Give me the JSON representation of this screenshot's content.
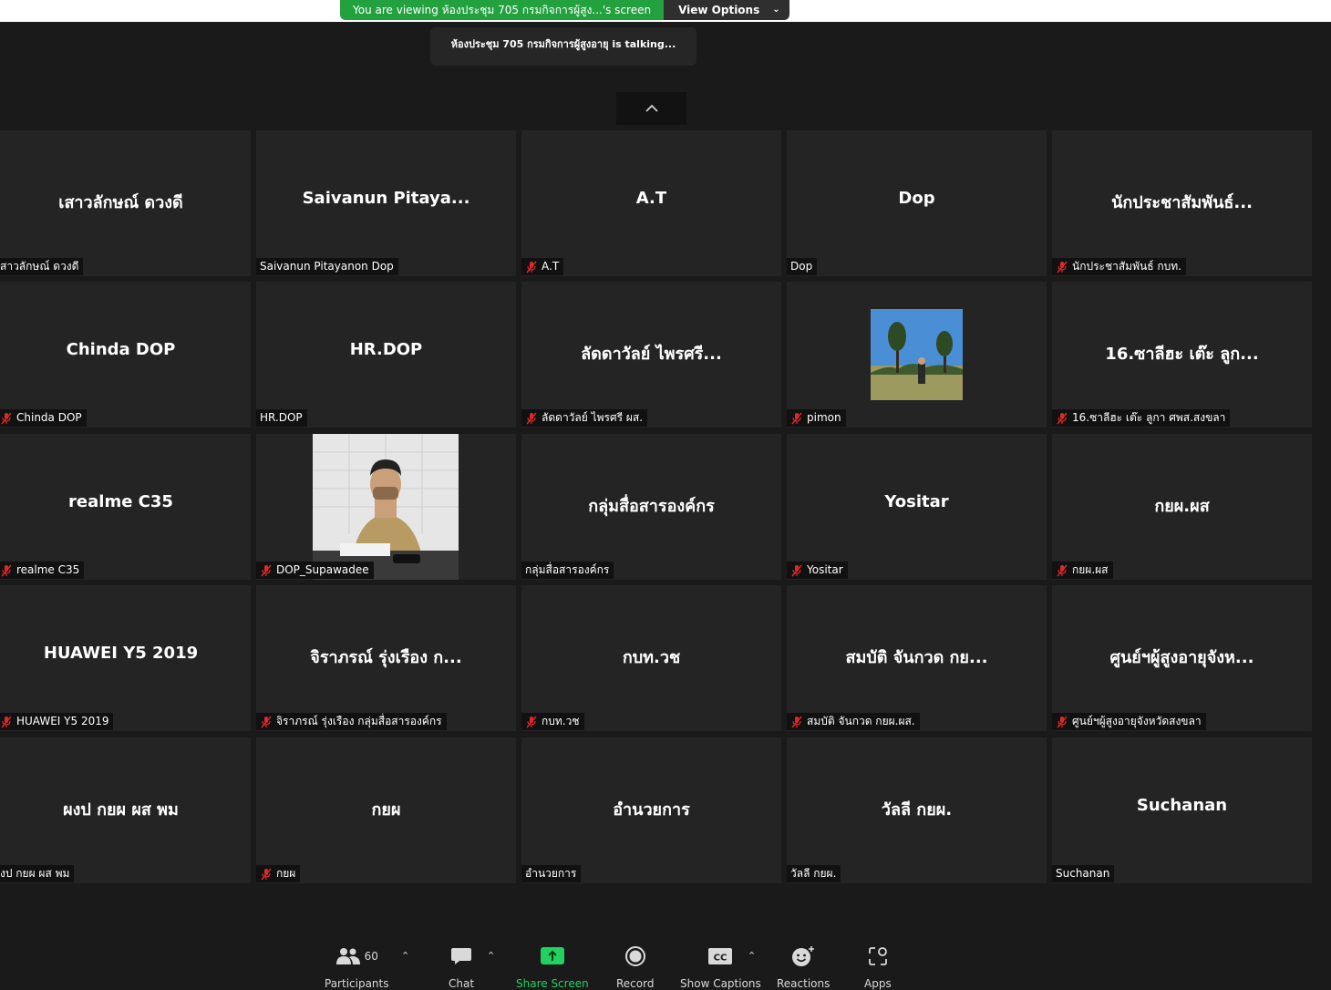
{
  "banner": {
    "viewing_text": "You are viewing ห้องประชุม 705 กรมกิจการผู้สูง...'s screen",
    "view_options": "View Options"
  },
  "talking_notice": "ห้องประชุม 705 กรมกิจการผู้สูงอายุ is talking...",
  "tiles": [
    {
      "title": "เสาวลักษณ์ ดวงดี",
      "label": "สาวลักษณ์ ดวงดี",
      "muted": false
    },
    {
      "title": "Saivanun  Pitaya...",
      "label": "Saivanun Pitayanon Dop",
      "muted": false
    },
    {
      "title": "A.T",
      "label": "A.T",
      "muted": true
    },
    {
      "title": "Dop",
      "label": "Dop",
      "muted": false
    },
    {
      "title": "นักประชาสัมพันธ์...",
      "label": "นักประชาสัมพันธ์ กบท.",
      "muted": true
    },
    {
      "title": "Chinda DOP",
      "label": "Chinda DOP",
      "muted": true
    },
    {
      "title": "HR.DOP",
      "label": "HR.DOP",
      "muted": false
    },
    {
      "title": "ลัดดาวัลย์ ไพรศรี...",
      "label": "ลัดดาวัลย์ ไพรศรี ผส.",
      "muted": true
    },
    {
      "title": "",
      "label": "pimon",
      "muted": true,
      "photo": "pimon"
    },
    {
      "title": "16.ซาลีฮะ เต๊ะ ลูก...",
      "label": "16.ซาลีฮะ เต๊ะ ลูกา ศพส.สงขลา",
      "muted": true
    },
    {
      "title": "realme C35",
      "label": "realme C35",
      "muted": true
    },
    {
      "title": "",
      "label": "DOP_Supawadee",
      "muted": true,
      "photo": "video"
    },
    {
      "title": "กลุ่มสื่อสารองค์กร",
      "label": "กลุ่มสื่อสารองค์กร",
      "muted": false
    },
    {
      "title": "Yositar",
      "label": "Yositar",
      "muted": true
    },
    {
      "title": "กยผ.ผส",
      "label": "กยผ.ผส",
      "muted": true
    },
    {
      "title": "HUAWEI Y5 2019",
      "label": "HUAWEI Y5 2019",
      "muted": true
    },
    {
      "title": "จิราภรณ์ รุ่งเรือง ก...",
      "label": "จิราภรณ์ รุ่งเรือง กลุ่มสื่อสารองค์กร",
      "muted": true
    },
    {
      "title": "กบท.วช",
      "label": "กบท.วช",
      "muted": true
    },
    {
      "title": "สมบัติ จันกวด กย...",
      "label": "สมบัติ จันกวด กยผ.ผส.",
      "muted": true
    },
    {
      "title": "ศูนย์ฯผู้สูงอายุจังห...",
      "label": "ศูนย์ฯผู้สูงอายุจังหวัดสงขลา",
      "muted": true
    },
    {
      "title": "ผงป กยผ ผส พม",
      "label": "งป กยผ ผส พม",
      "muted": false
    },
    {
      "title": "กยผ",
      "label": "กยผ",
      "muted": true
    },
    {
      "title": "อำนวยการ",
      "label": "อำนวยการ",
      "muted": false
    },
    {
      "title": "วัลลี กยผ.",
      "label": "วัลลี กยผ.",
      "muted": false
    },
    {
      "title": "Suchanan",
      "label": "Suchanan",
      "muted": false
    }
  ],
  "toolbar": {
    "participants_label": "Participants",
    "participants_count": "60",
    "chat_label": "Chat",
    "share_label": "Share Screen",
    "record_label": "Record",
    "captions_label": "Show Captions",
    "cc_text": "CC",
    "reactions_label": "Reactions",
    "apps_label": "Apps"
  },
  "colors": {
    "banner_green": "#23a13f",
    "share_green": "#23d160",
    "muted_red": "#e02828",
    "tile_bg": "#242424"
  }
}
